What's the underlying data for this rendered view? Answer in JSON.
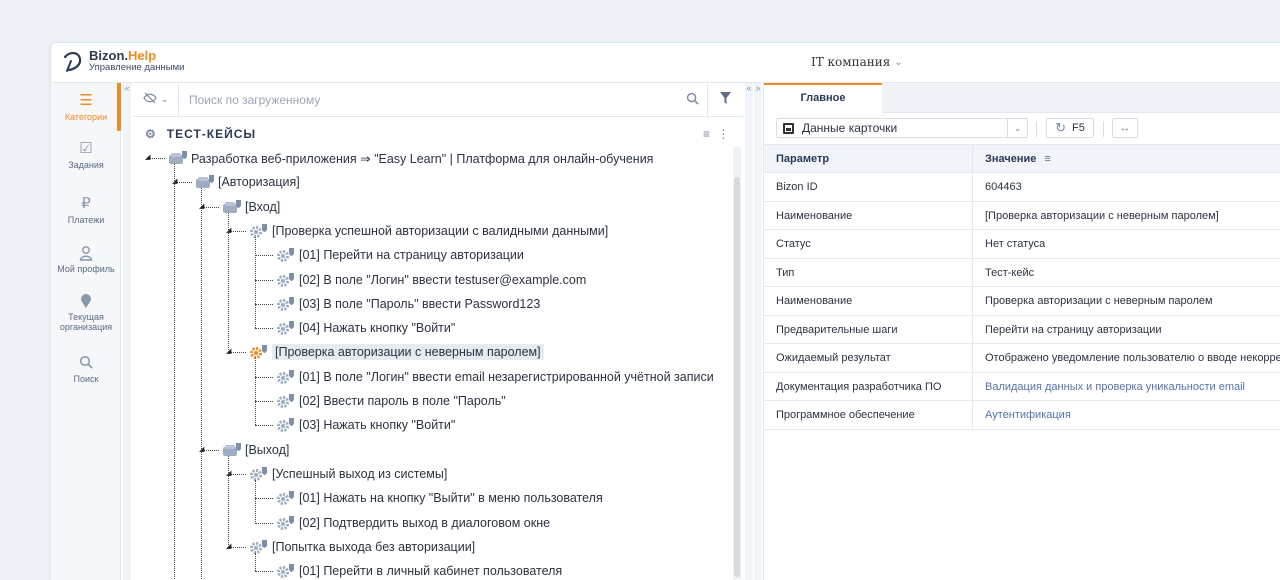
{
  "app": {
    "brand_main": "Bizon.",
    "brand_accent": "Help",
    "subtitle": "Управление данными",
    "company": "IT компания"
  },
  "nav": [
    {
      "label": "Категории",
      "icon": "menu-icon",
      "active": true
    },
    {
      "label": "Задания",
      "icon": "checkbox-icon"
    },
    {
      "label": "Платежи",
      "icon": "ruble-icon"
    },
    {
      "label": "Мой профиль",
      "icon": "user-icon"
    },
    {
      "label": "Текущая организация",
      "icon": "location-pin-icon"
    },
    {
      "label": "Поиск",
      "icon": "search-icon"
    }
  ],
  "search": {
    "placeholder": "Поиск по загруженному"
  },
  "tree": {
    "title": "ТЕСТ-КЕЙСЫ",
    "nodes": [
      {
        "label": "Разработка веб-приложения ⇒ \"Easy Learn\" | Платформа для онлайн-обучения",
        "level": 0,
        "type": "folder"
      },
      {
        "label": "[Авторизация]",
        "level": 1,
        "type": "folder"
      },
      {
        "label": "[Вход]",
        "level": 2,
        "type": "folder"
      },
      {
        "label": "[Проверка успешной авторизации с валидными данными]",
        "level": 3,
        "type": "case"
      },
      {
        "label": "[01] Перейти на страницу авторизации",
        "level": 4,
        "type": "step"
      },
      {
        "label": "[02] В поле \"Логин\" ввести testuser@example.com",
        "level": 4,
        "type": "step"
      },
      {
        "label": "[03] В поле \"Пароль\" ввести Password123",
        "level": 4,
        "type": "step"
      },
      {
        "label": "[04] Нажать кнопку \"Войти\"",
        "level": 4,
        "type": "step"
      },
      {
        "label": "[Проверка авторизации с неверным паролем]",
        "level": 3,
        "type": "case",
        "selected": true
      },
      {
        "label": "[01] В поле \"Логин\" ввести email незарегистрированной учётной записи",
        "level": 4,
        "type": "step"
      },
      {
        "label": "[02] Ввести пароль в поле \"Пароль\"",
        "level": 4,
        "type": "step"
      },
      {
        "label": "[03] Нажать кнопку \"Войти\"",
        "level": 4,
        "type": "step"
      },
      {
        "label": "[Выход]",
        "level": 2,
        "type": "folder"
      },
      {
        "label": "[Успешный выход из системы]",
        "level": 3,
        "type": "case"
      },
      {
        "label": "[01] Нажать на кнопку \"Выйти\" в меню пользователя",
        "level": 4,
        "type": "step"
      },
      {
        "label": "[02] Подтвердить выход в диалоговом окне",
        "level": 4,
        "type": "step"
      },
      {
        "label": "[Попытка выхода без авторизации]",
        "level": 3,
        "type": "case"
      },
      {
        "label": "[01] Перейти в личный кабинет пользователя",
        "level": 4,
        "type": "step"
      }
    ]
  },
  "details": {
    "tab": "Главное",
    "card_select": "Данные карточки",
    "refresh_label": "F5",
    "col_param": "Параметр",
    "col_value": "Значение",
    "rows": [
      {
        "param": "Bizon ID",
        "value": "604463"
      },
      {
        "param": "Наименование",
        "value": "[Проверка авторизации с неверным паролем]"
      },
      {
        "param": "Статус",
        "value": "Нет статуса"
      },
      {
        "param": "Тип",
        "value": "Тест-кейс"
      },
      {
        "param": "Наименование",
        "value": "Проверка авторизации с неверным паролем"
      },
      {
        "param": "Предварительные шаги",
        "value": "Перейти на страницу авторизации"
      },
      {
        "param": "Ожидаемый результат",
        "value": "Отображено уведомление пользователю о вводе некорректного пароля"
      },
      {
        "param": "Документация разработчика ПО",
        "value": "Валидация данных и проверка уникальности email",
        "link": true
      },
      {
        "param": "Программное обеспечение",
        "value": "Аутентификация",
        "link": true
      }
    ]
  },
  "colors": {
    "accent": "#f08a24",
    "link": "#5574a8",
    "background": "#eef2f8"
  }
}
